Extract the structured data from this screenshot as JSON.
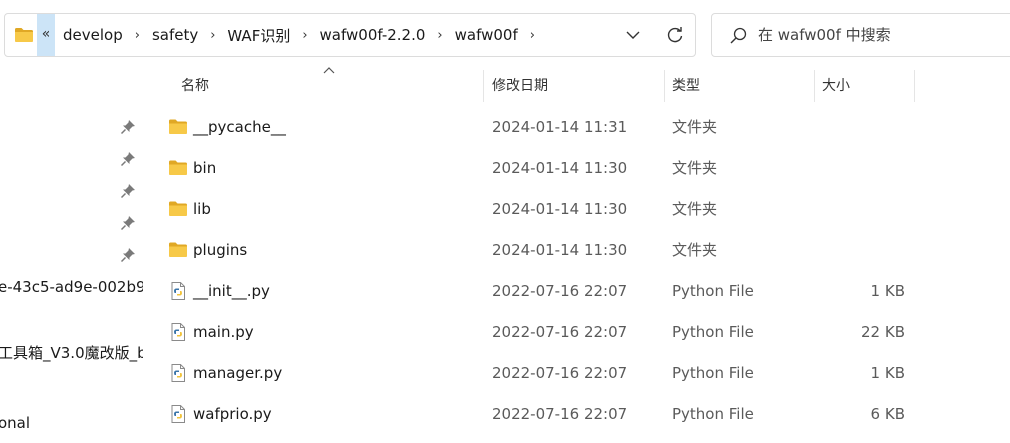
{
  "address": {
    "back_chevron": "«",
    "crumbs": [
      "develop",
      "safety",
      "WAF识别",
      "wafw00f-2.2.0",
      "wafw00f"
    ],
    "separator": "›"
  },
  "search": {
    "placeholder": "在 wafw00f 中搜索"
  },
  "nav": {
    "items": [
      "e-43c5-ad9e-002b9",
      "工具箱_V3.0魔改版_b",
      "onal"
    ]
  },
  "columns": {
    "name": "名称",
    "date": "修改日期",
    "type": "类型",
    "size": "大小"
  },
  "files": [
    {
      "name": "__pycache__",
      "date": "2024-01-14 11:31",
      "type": "文件夹",
      "size": "",
      "icon": "folder-icon"
    },
    {
      "name": "bin",
      "date": "2024-01-14 11:30",
      "type": "文件夹",
      "size": "",
      "icon": "folder-icon"
    },
    {
      "name": "lib",
      "date": "2024-01-14 11:30",
      "type": "文件夹",
      "size": "",
      "icon": "folder-icon"
    },
    {
      "name": "plugins",
      "date": "2024-01-14 11:30",
      "type": "文件夹",
      "size": "",
      "icon": "folder-icon"
    },
    {
      "name": "__init__.py",
      "date": "2022-07-16 22:07",
      "type": "Python File",
      "size": "1 KB",
      "icon": "python-file-icon"
    },
    {
      "name": "main.py",
      "date": "2022-07-16 22:07",
      "type": "Python File",
      "size": "22 KB",
      "icon": "python-file-icon"
    },
    {
      "name": "manager.py",
      "date": "2022-07-16 22:07",
      "type": "Python File",
      "size": "1 KB",
      "icon": "python-file-icon"
    },
    {
      "name": "wafprio.py",
      "date": "2022-07-16 22:07",
      "type": "Python File",
      "size": "6 KB",
      "icon": "python-file-icon"
    }
  ],
  "colors": {
    "folder": "#f7c948",
    "folder_dark": "#e0a825",
    "selection": "#cce4f7",
    "python_blue": "#3a74a8",
    "python_yellow": "#f2c43c"
  }
}
